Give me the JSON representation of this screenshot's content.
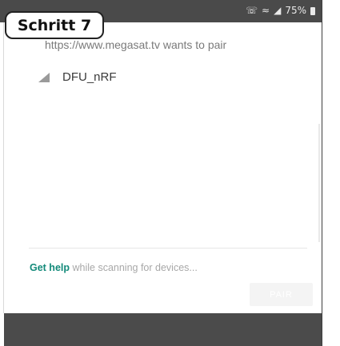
{
  "status_bar": {
    "icons": [
      "call-icon",
      "wifi-icon",
      "signal-icon",
      "battery-icon"
    ],
    "battery_level": "75%"
  },
  "step_badge": {
    "label": "Schritt 7"
  },
  "dialog": {
    "prompt": "https://www.megasat.tv wants to pair",
    "devices": [
      {
        "name": "DFU_nRF",
        "icon": "signal-strength-icon"
      }
    ],
    "help_link": "Get help",
    "help_text": " while scanning for devices...",
    "pair_button": "PAIR"
  },
  "colors": {
    "status_bar_bg": "#4a4a4a",
    "link": "#138a7a",
    "nav_bar_bg": "#4b4b4b"
  }
}
